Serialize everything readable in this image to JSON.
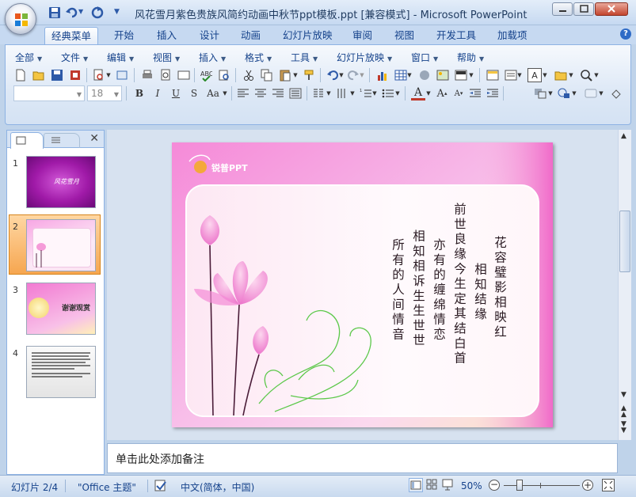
{
  "window": {
    "title": "风花雪月紫色贵族风简约动画中秋节ppt模板.ppt [兼容模式] - Microsoft PowerPoint"
  },
  "ribbon_tabs": [
    "经典菜单",
    "开始",
    "插入",
    "设计",
    "动画",
    "幻灯片放映",
    "审阅",
    "视图",
    "开发工具",
    "加载项"
  ],
  "classic_menu": [
    "全部",
    "文件",
    "编辑",
    "视图",
    "插入",
    "格式",
    "工具",
    "幻灯片放映",
    "窗口",
    "帮助"
  ],
  "font_combo": {
    "font": "",
    "size": "18"
  },
  "format_buttons": [
    "B",
    "I",
    "U",
    "S",
    "Aa"
  ],
  "thumbnails": [
    {
      "num": "1",
      "text": "风花雪月"
    },
    {
      "num": "2",
      "text": ""
    },
    {
      "num": "3",
      "text": "谢谢观赏"
    },
    {
      "num": "4",
      "text": ""
    }
  ],
  "slide": {
    "logo_text": "锐普PPT",
    "poem_columns": [
      "花容璧影相映红",
      "相知结缘",
      "前世良缘今生定其结白首",
      "亦有的缠绵情恋",
      "相知相诉生生世世",
      "所有的人间情音"
    ]
  },
  "notes_placeholder": "单击此处添加备注",
  "status": {
    "slide_counter": "幻灯片 2/4",
    "theme": "\"Office 主题\"",
    "language": "中文(简体，中国)",
    "zoom": "50%"
  },
  "colors": {
    "accent": "#15428b",
    "slide_pink": "#f06ac9"
  }
}
